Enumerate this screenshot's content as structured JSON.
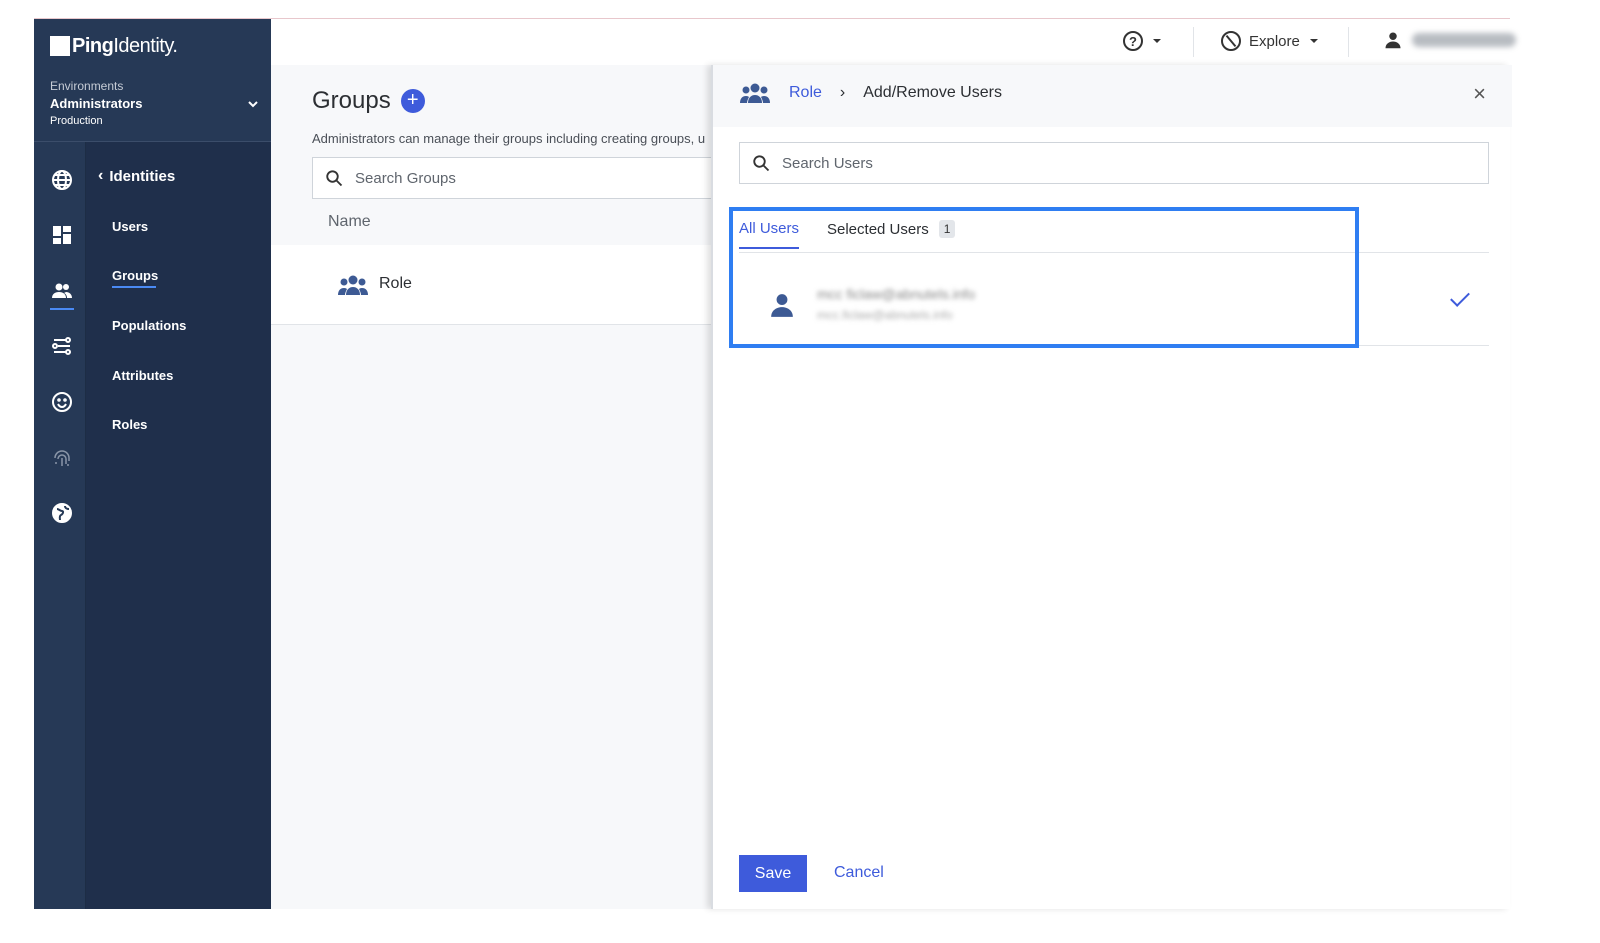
{
  "brand": {
    "logo_bold": "Ping",
    "logo_rest": "Identity."
  },
  "environment": {
    "label": "Environments",
    "name": "Administrators",
    "type": "Production"
  },
  "rail_icons": [
    "globe-icon",
    "dashboard-icon",
    "users-icon",
    "connections-icon",
    "smiley-icon",
    "fingerprint-icon",
    "world-icon"
  ],
  "subnav": {
    "back_label": "Identities",
    "items": [
      {
        "label": "Users"
      },
      {
        "label": "Groups",
        "active": true
      },
      {
        "label": "Populations"
      },
      {
        "label": "Attributes"
      },
      {
        "label": "Roles"
      }
    ]
  },
  "topbar": {
    "explore_label": "Explore"
  },
  "groups": {
    "title": "Groups",
    "add_symbol": "+",
    "description": "Administrators can manage their groups including creating groups, u",
    "search_placeholder": "Search Groups",
    "column_name": "Name",
    "rows": [
      {
        "name": "Role"
      }
    ]
  },
  "panel": {
    "breadcrumb_root": "Role",
    "breadcrumb_sep": "›",
    "breadcrumb_current": "Add/Remove Users",
    "close_symbol": "×",
    "search_placeholder": "Search Users",
    "tabs": {
      "all": "All Users",
      "selected": "Selected Users",
      "selected_count": "1"
    },
    "user": {
      "name": "mcc ficlaw@abnutels.info",
      "email": "mcc.ficlaw@abnutels.info"
    },
    "save_label": "Save",
    "cancel_label": "Cancel"
  },
  "colors": {
    "sidebar": "#263956",
    "subnav": "#1f2f4b",
    "accent": "#3e5bdb",
    "highlight": "#2f7ef2"
  }
}
